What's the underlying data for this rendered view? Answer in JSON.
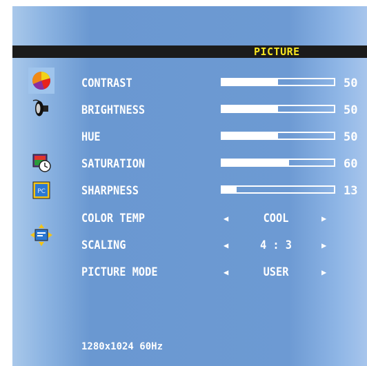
{
  "menu": {
    "title": "PICTURE",
    "icons": [
      "color-palette-icon",
      "speaker-icon",
      "clock-window-icon",
      "pc-icon",
      "position-arrows-icon"
    ],
    "selected_icon": "color-palette-icon"
  },
  "settings": {
    "contrast": {
      "label": "CONTRAST",
      "value": "50",
      "level": 0.5
    },
    "brightness": {
      "label": "BRIGHTNESS",
      "value": "50",
      "level": 0.5
    },
    "hue": {
      "label": "HUE",
      "value": "50",
      "level": 0.5
    },
    "saturation": {
      "label": "SATURATION",
      "value": "60",
      "level": 0.6
    },
    "sharpness": {
      "label": "SHARPNESS",
      "value": "13",
      "level": 0.13
    },
    "color_temp": {
      "label": "COLOR TEMP",
      "value": "COOL"
    },
    "scaling": {
      "label": "SCALING",
      "value": "4 : 3"
    },
    "picture_mode": {
      "label": "PICTURE MODE",
      "value": "USER"
    }
  },
  "status": {
    "resolution": "1280x1024 60Hz"
  },
  "colors": {
    "background": "#6d9ad3",
    "title_bar": "#1b1b1b",
    "title_text": "#f6e41f",
    "text": "#ffffff"
  }
}
